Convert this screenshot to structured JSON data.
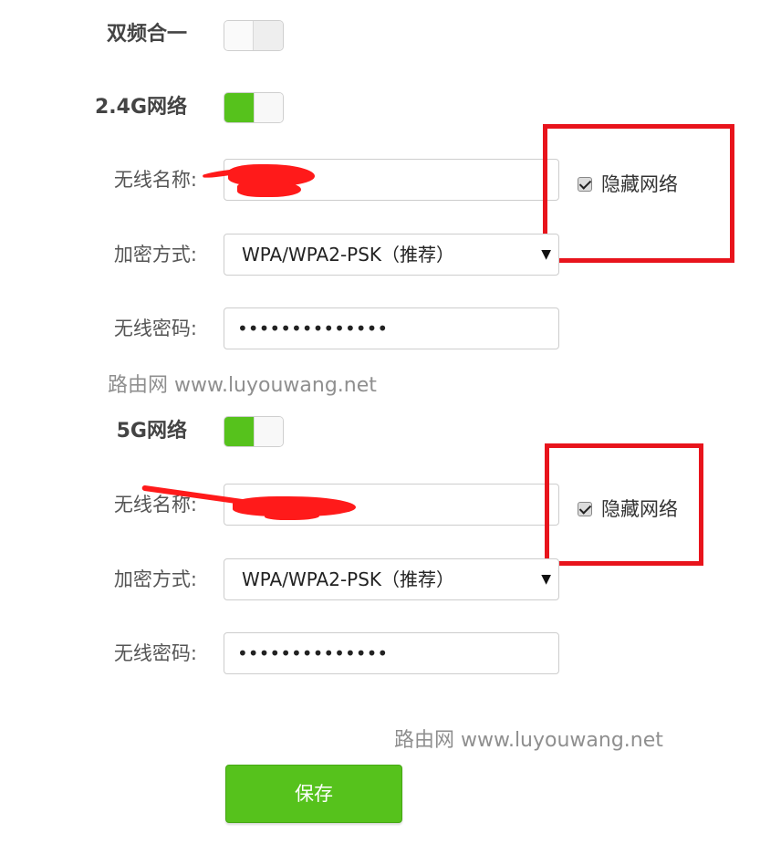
{
  "dual_band": {
    "heading": "双频合一",
    "enabled": false
  },
  "band_24g": {
    "heading": "2.4G网络",
    "enabled": true,
    "ssid_label": "无线名称:",
    "ssid_value": "",
    "hide_network_label": "隐藏网络",
    "hide_network_checked": true,
    "encryption_label": "加密方式:",
    "encryption_value": "WPA/WPA2-PSK（推荐）",
    "password_label": "无线密码:",
    "password_value": "••••••••••••••"
  },
  "band_5g": {
    "heading": "5G网络",
    "enabled": true,
    "ssid_label": "无线名称:",
    "ssid_value": "",
    "hide_network_label": "隐藏网络",
    "hide_network_checked": true,
    "encryption_label": "加密方式:",
    "encryption_value": "WPA/WPA2-PSK（推荐）",
    "password_label": "无线密码:",
    "password_value": "••••••••••••••"
  },
  "watermarks": {
    "first": "路由网 www.luyouwang.net",
    "second": "路由网 www.luyouwang.net"
  },
  "save_button_label": "保存",
  "colors": {
    "accent_green": "#56c21c",
    "annotation_red": "#e8141c"
  },
  "icons": {
    "select_arrow": "chevron-down-icon"
  }
}
